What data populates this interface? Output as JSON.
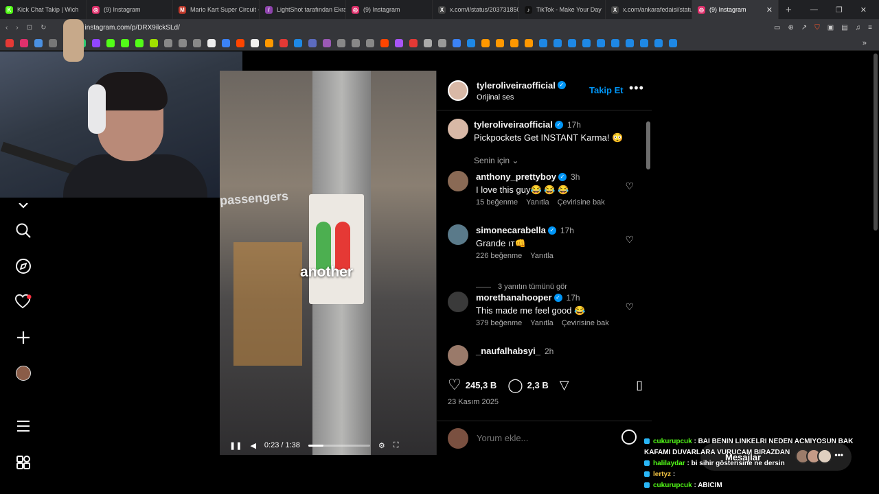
{
  "tabs": [
    {
      "title": "Kick Chat Takip | Wich",
      "color": "#53fc18",
      "glyph": "K"
    },
    {
      "title": "(9) Instagram",
      "color": "#e1306c",
      "glyph": "◎"
    },
    {
      "title": "Mario Kart Super Circuit -",
      "color": "#c0392b",
      "glyph": "M"
    },
    {
      "title": "LightShot tarafından Ekran",
      "color": "#8e44ad",
      "glyph": "/"
    },
    {
      "title": "(9) Instagram",
      "color": "#e1306c",
      "glyph": "◎"
    },
    {
      "title": "x.com/i/status/203731850",
      "color": "#444",
      "glyph": "X"
    },
    {
      "title": "TikTok - Make Your Day",
      "color": "#111",
      "glyph": "♪"
    },
    {
      "title": "x.com/ankarafedaisi/statu",
      "color": "#444",
      "glyph": "X"
    },
    {
      "title": "(9) Instagram",
      "color": "#e1306c",
      "glyph": "◎",
      "active": true
    }
  ],
  "address": {
    "url": "instagram.com/p/DRX9ilckSLd/"
  },
  "bookmark_colors": [
    "#e53935",
    "#e1306c",
    "#4a90e2",
    "#777",
    "#ffffff",
    "#2ecc71",
    "#9146ff",
    "#53fc18",
    "#53fc18",
    "#53fc18",
    "#a0e000",
    "#888",
    "#888",
    "#888",
    "#eee",
    "#3b82f6",
    "#ff4500",
    "#f0f0f0",
    "#ff9800",
    "#e53935",
    "#1e88e5",
    "#5c6bc0",
    "#9b59b6",
    "#888",
    "#888",
    "#888",
    "#ff4500",
    "#a855f7",
    "#e53935",
    "#aaa",
    "#999",
    "#3b82f6",
    "#1e88e5",
    "#ff9800",
    "#ff9800",
    "#ff9800",
    "#ff9800",
    "#1e88e5",
    "#1e88e5",
    "#1e88e5",
    "#1e88e5",
    "#1e88e5",
    "#1e88e5",
    "#1e88e5",
    "#1e88e5",
    "#1e88e5",
    "#1e88e5"
  ],
  "nav": {
    "icons": [
      "home-icon",
      "search-icon",
      "explore-icon",
      "notifications-icon",
      "create-icon",
      "profile-icon",
      "menu-icon",
      "more-apps-icon"
    ]
  },
  "video": {
    "caption_word": "another",
    "sign_text": "passengers",
    "time": "0:23 / 1:38",
    "progress": 0.24
  },
  "post": {
    "author": "tyleroliveiraofficial",
    "audio": "Orijinal ses",
    "follow_label": "Takip Et",
    "more_label": "•••",
    "caption_time": "17h",
    "caption": "Pickpockets Get INSTANT Karma! 😳",
    "filter_label": "Senin için",
    "likes": "245,3 B",
    "comments_count": "2,3 B",
    "date": "23 Kasım 2025",
    "add_comment_placeholder": "Yorum ekle..."
  },
  "comments": [
    {
      "user": "anthony_prettyboy",
      "verified": true,
      "time": "3h",
      "text": "I love this guy😂 😂 😂",
      "likes": "15 beğenme",
      "reply": "Yanıtla",
      "translate": "Çevirisine bak",
      "avatar": "#8a6a55"
    },
    {
      "user": "simonecarabella",
      "verified": true,
      "time": "17h",
      "text": "Grande ıт👊",
      "likes": "226 beğenme",
      "reply": "Yanıtla",
      "translate": "",
      "avatar": "#5a7a8a"
    },
    {
      "user": "morethanahooper",
      "verified": true,
      "time": "17h",
      "text": "This made me feel good 😂",
      "likes": "379 beğenme",
      "reply": "Yanıtla",
      "translate": "Çevirisine bak",
      "avatar": "#3a3a3a"
    },
    {
      "user": "_naufalhabsyi_",
      "verified": false,
      "time": "2h",
      "text": "",
      "likes": "",
      "reply": "",
      "translate": "",
      "avatar": "#9a7a6a"
    }
  ],
  "replies_label": "3 yanıtın tümünü gör",
  "messages": {
    "label": "Mesajlar",
    "more": "•••"
  },
  "chat": [
    {
      "user": "cukurupcuk",
      "text": "BAI BENIN LINKELRI NEDEN ACMIYOSUN BAK KAFAMI DUVARLARA VURUCAM BIRAZDAN",
      "color": "#53fc18"
    },
    {
      "user": "halilaydar",
      "text": "bi sihir gösterisine ne dersin",
      "color": "#53fc18"
    },
    {
      "user": "lertyz",
      "text": "",
      "color": "#f5c542"
    },
    {
      "user": "cukurupcuk",
      "text": "ABICIM",
      "color": "#53fc18"
    }
  ]
}
